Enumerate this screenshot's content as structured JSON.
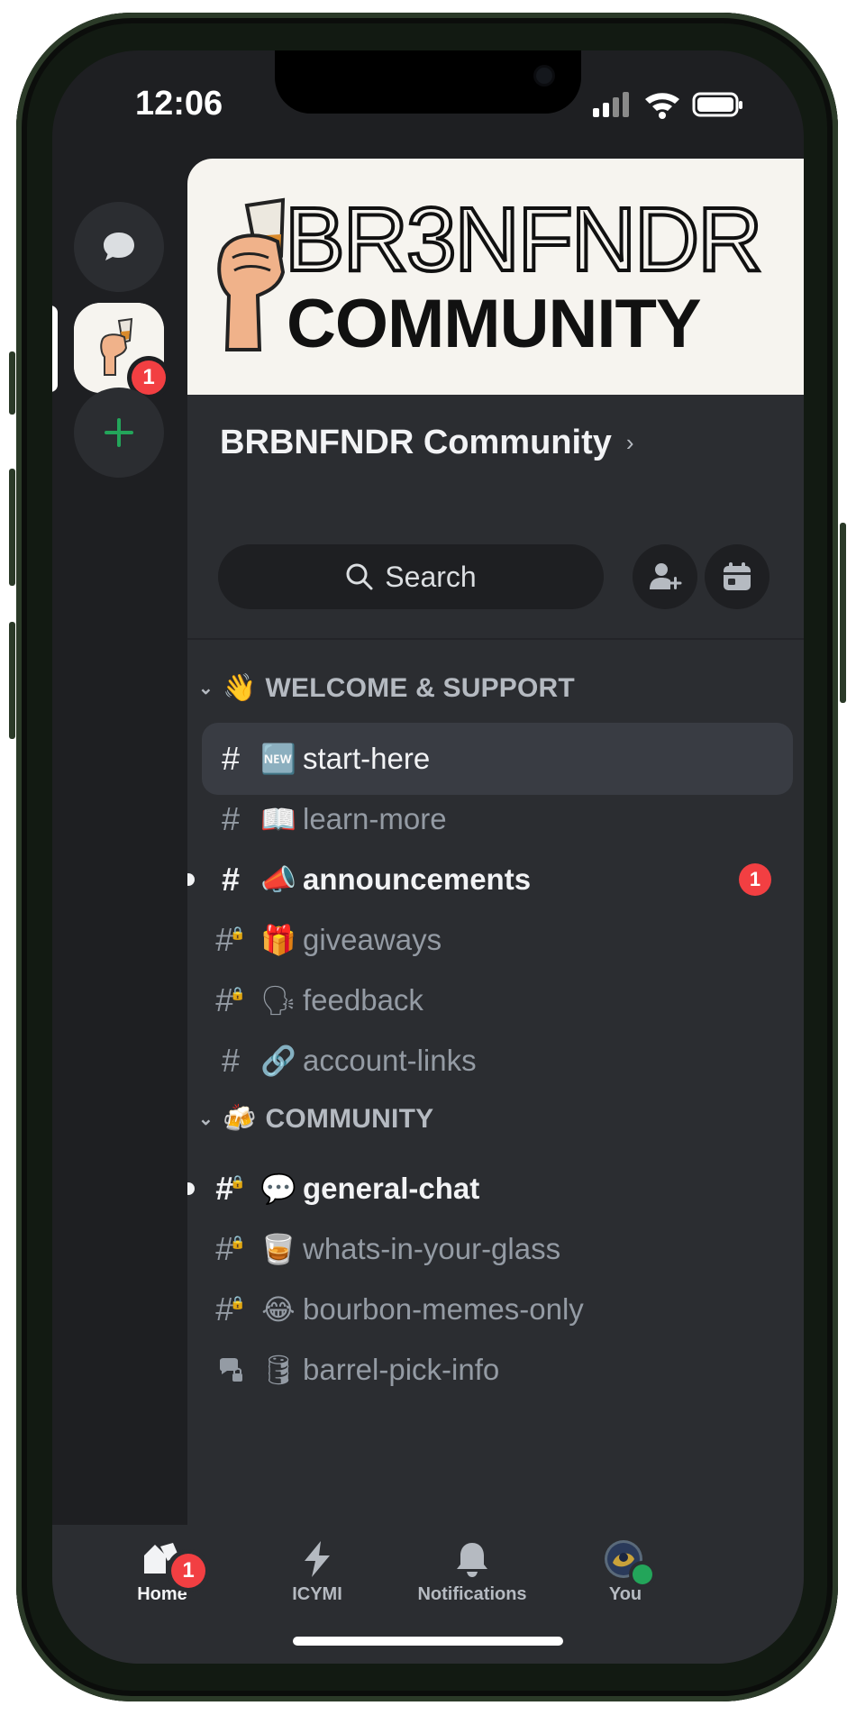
{
  "status_bar": {
    "time": "12:06"
  },
  "server": {
    "banner_line1": "BR3NFNDR",
    "banner_line2": "COMMUNITY",
    "name": "BRBNFNDR Community",
    "badge": "1"
  },
  "search": {
    "label": "Search"
  },
  "categories": [
    {
      "emoji": "👋",
      "label": "WELCOME & SUPPORT"
    },
    {
      "emoji": "🍻",
      "label": "COMMUNITY"
    }
  ],
  "channels": [
    {
      "emoji": "🆕",
      "name": "start-here"
    },
    {
      "emoji": "📖",
      "name": "learn-more"
    },
    {
      "emoji": "📣",
      "name": "announcements",
      "badge": "1"
    },
    {
      "emoji": "🎁",
      "name": "giveaways"
    },
    {
      "emoji": "🗣",
      "name": "feedback"
    },
    {
      "emoji": "🔗",
      "name": "account-links"
    },
    {
      "emoji": "💬",
      "name": "general-chat"
    },
    {
      "emoji": "🥃",
      "name": "whats-in-your-glass"
    },
    {
      "emoji": "😂",
      "name": "bourbon-memes-only"
    },
    {
      "emoji": "🛢",
      "name": "barrel-pick-info"
    }
  ],
  "tabs": {
    "home": "Home",
    "home_badge": "1",
    "icymi": "ICYMI",
    "notifications": "Notifications",
    "you": "You"
  },
  "colors": {
    "background": "#1e1f22",
    "panel": "#2b2d31",
    "accent_green": "#23a55a",
    "badge_red": "#f23f42"
  }
}
